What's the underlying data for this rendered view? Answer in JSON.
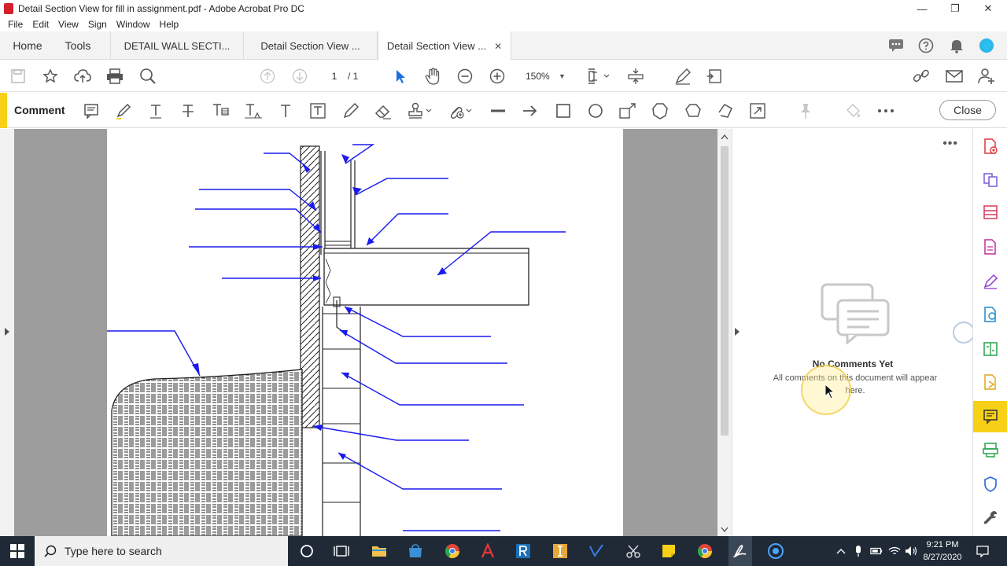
{
  "window": {
    "title": "Detail Section View for fill in assignment.pdf - Adobe Acrobat Pro DC",
    "minimize_glyph": "—",
    "restore_glyph": "❐",
    "close_glyph": "✕"
  },
  "menu": [
    "File",
    "Edit",
    "View",
    "Sign",
    "Window",
    "Help"
  ],
  "tabs": {
    "home": "Home",
    "tools": "Tools",
    "docs": [
      "DETAIL WALL SECTI...",
      "Detail Section View ...",
      "Detail Section View ..."
    ],
    "close_glyph": "✕"
  },
  "toolbar": {
    "page_current": "1",
    "page_total": "/ 1",
    "zoom": "150%"
  },
  "comment_bar": {
    "label": "Comment",
    "close_label": "Close",
    "accent_color": "#f7d117"
  },
  "panel": {
    "more_glyph": "•••",
    "no_comments_title": "No Comments Yet",
    "no_comments_sub": "All comments on this document will appear here."
  },
  "taskbar": {
    "search_placeholder": "Type here to search",
    "time": "9:21 PM",
    "date": "8/27/2020"
  },
  "colors": {
    "annotation_blue": "#1a1af0",
    "accent_yellow": "#f7d117",
    "acrobat_red": "#d4202a",
    "taskbar": "#1f2a36"
  }
}
